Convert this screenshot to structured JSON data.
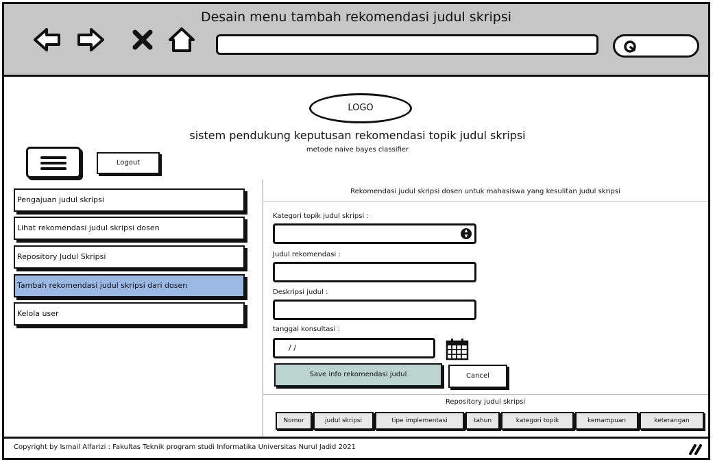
{
  "window": {
    "title": "Desain menu tambah rekomendasi judul skripsi"
  },
  "header": {
    "logo": "LOGO",
    "title": "sistem pendukung keputusan rekomendasi topik judul skripsi",
    "subtitle": "metode naive bayes classifier",
    "logout_label": "Logout"
  },
  "sidebar": {
    "items": [
      {
        "label": "Pengajuan judul skripsi"
      },
      {
        "label": "Lihat rekomendasi judul skripsi dosen"
      },
      {
        "label": "Repository Judul Skripsi"
      },
      {
        "label": "Tambah rekomendasi judul skripsi dari dosen"
      },
      {
        "label": "Kelola user"
      }
    ]
  },
  "form": {
    "heading": "Rekomendasi judul skripsi dosen untuk mahasiswa yang kesulitan judul skripsi",
    "kategori_label": "Kategori topik judul skripsi :",
    "judul_label": "Judul rekomendasi :",
    "deskripsi_label": "Deskripsi judul :",
    "tanggal_label": "tanggal konsultasi :",
    "tanggal_value": "/ /",
    "save_label": "Save info rekomendasi judul",
    "cancel_label": "Cancel"
  },
  "repository": {
    "heading": "Repository judul skripsi",
    "columns": [
      "Nomor",
      "judul skripsi",
      "tipe implementasi",
      "tahun",
      "kategori topik",
      "kemampuan",
      "keterangan"
    ]
  },
  "footer": {
    "text": "Copyright by Ismail Alfarizi : Fakultas Teknik program studi Informatika Universitas Nurul Jadid 2021"
  },
  "colors": {
    "chrome": "#c6c6c6",
    "active": "#9bb7e4",
    "save": "#bcd4cf"
  }
}
